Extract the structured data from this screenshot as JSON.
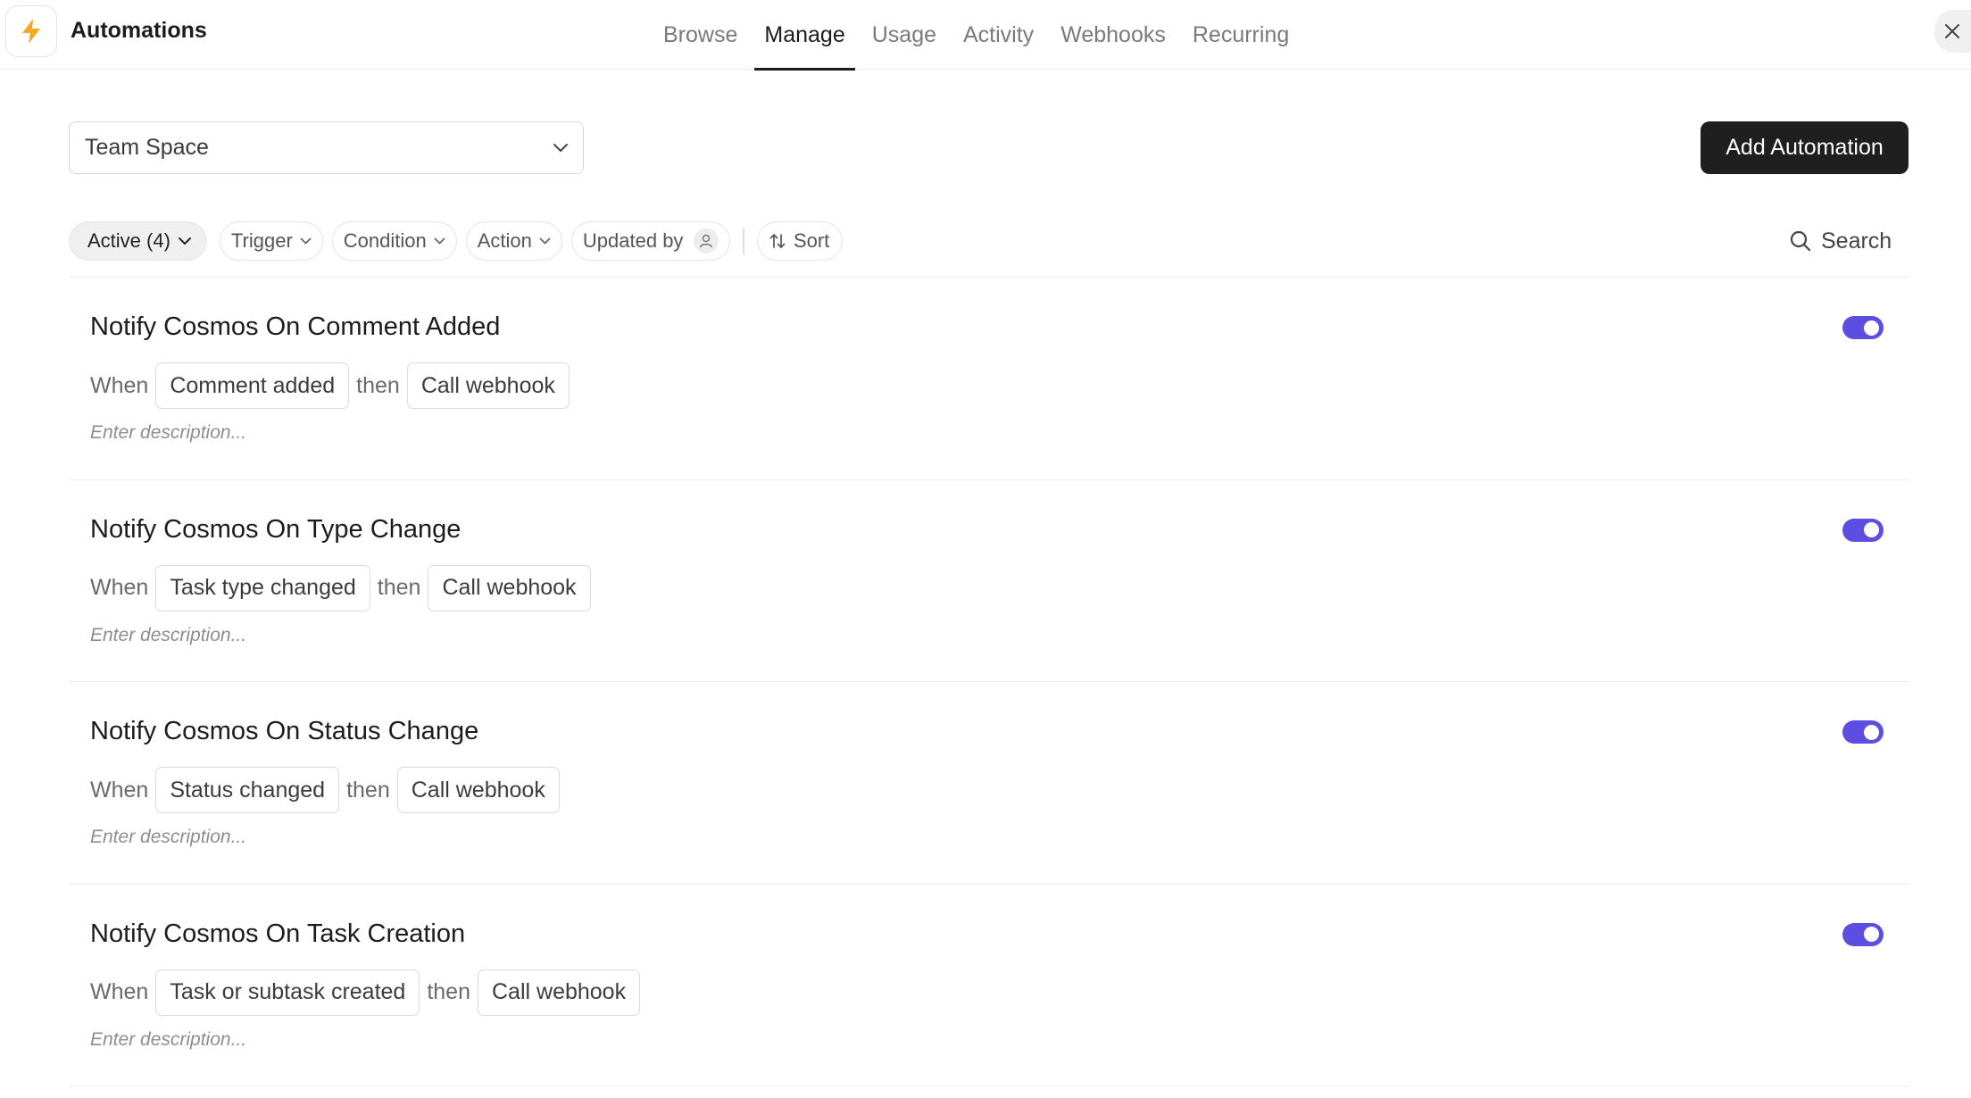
{
  "app": {
    "title": "Automations",
    "logo_icon": "lightning-bolt-icon",
    "accent_color": "#f5a623"
  },
  "tabs": [
    {
      "label": "Browse",
      "active": false
    },
    {
      "label": "Manage",
      "active": true
    },
    {
      "label": "Usage",
      "active": false
    },
    {
      "label": "Activity",
      "active": false
    },
    {
      "label": "Webhooks",
      "active": false
    },
    {
      "label": "Recurring",
      "active": false
    }
  ],
  "space_select": {
    "value": "Team Space"
  },
  "add_button": {
    "label": "Add Automation"
  },
  "filters": {
    "active_label": "Active (4)",
    "trigger_label": "Trigger",
    "condition_label": "Condition",
    "action_label": "Action",
    "updated_by_label": "Updated by",
    "sort_label": "Sort",
    "search_label": "Search"
  },
  "toggle_color": "#5b4ee0",
  "automations": [
    {
      "title": "Notify Cosmos On Comment Added",
      "when": "When",
      "trigger": "Comment added",
      "then": "then",
      "action": "Call webhook",
      "description_placeholder": "Enter description...",
      "enabled": true
    },
    {
      "title": "Notify Cosmos On Type Change",
      "when": "When",
      "trigger": "Task type changed",
      "then": "then",
      "action": "Call webhook",
      "description_placeholder": "Enter description...",
      "enabled": true
    },
    {
      "title": "Notify Cosmos On Status Change",
      "when": "When",
      "trigger": "Status changed",
      "then": "then",
      "action": "Call webhook",
      "description_placeholder": "Enter description...",
      "enabled": true
    },
    {
      "title": "Notify Cosmos On Task Creation",
      "when": "When",
      "trigger": "Task or subtask created",
      "then": "then",
      "action": "Call webhook",
      "description_placeholder": "Enter description...",
      "enabled": true
    }
  ]
}
